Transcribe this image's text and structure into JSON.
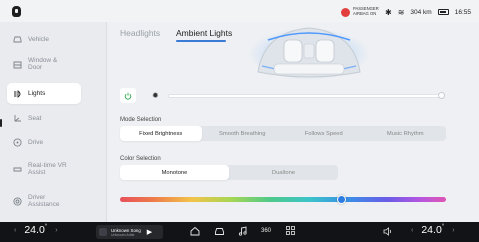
{
  "status_bar": {
    "airbag_text": "PASSENGER AIRBAG ON",
    "range": "304 km",
    "time": "16:55",
    "icons": [
      "airbag-warning-icon",
      "bluetooth-icon",
      "wifi-icon",
      "battery-icon"
    ]
  },
  "sidebar": {
    "items": [
      {
        "label": "Vehicle",
        "icon": "car-icon"
      },
      {
        "label": "Window & Door",
        "icon": "window-door-icon"
      },
      {
        "label": "Lights",
        "icon": "lights-icon",
        "active": true
      },
      {
        "label": "Seat",
        "icon": "seat-icon"
      },
      {
        "label": "Drive",
        "icon": "steering-wheel-icon"
      },
      {
        "label": "Real-time VR Assist",
        "icon": "vr-assist-icon"
      },
      {
        "label": "Driver Assistance",
        "icon": "driver-assistance-icon"
      }
    ]
  },
  "tabs": [
    {
      "label": "Headlights",
      "active": false
    },
    {
      "label": "Ambient Lights",
      "active": true
    }
  ],
  "ambient": {
    "power_on": true,
    "brightness_fraction": 1.0,
    "mode_label": "Mode Selection",
    "modes": [
      "Fixed Brightness",
      "Smooth Breathing",
      "Follows Speed",
      "Music Rhythm"
    ],
    "mode_selected": "Fixed Brightness",
    "color_label": "Color Selection",
    "color_types": [
      "Monotone",
      "Dualtone"
    ],
    "color_selected": "Monotone",
    "hue_fraction": 0.68,
    "selected_color": "#2d7ce3"
  },
  "dock": {
    "left_temp": "24.0",
    "right_temp": "24.0",
    "temp_unit": "°",
    "media_title": "Unknown Song",
    "media_artist": "Unknown Artist",
    "icons": [
      "home-icon",
      "car-icon",
      "music-icon",
      "camera-360-icon",
      "apps-grid-icon",
      "volume-icon"
    ]
  }
}
